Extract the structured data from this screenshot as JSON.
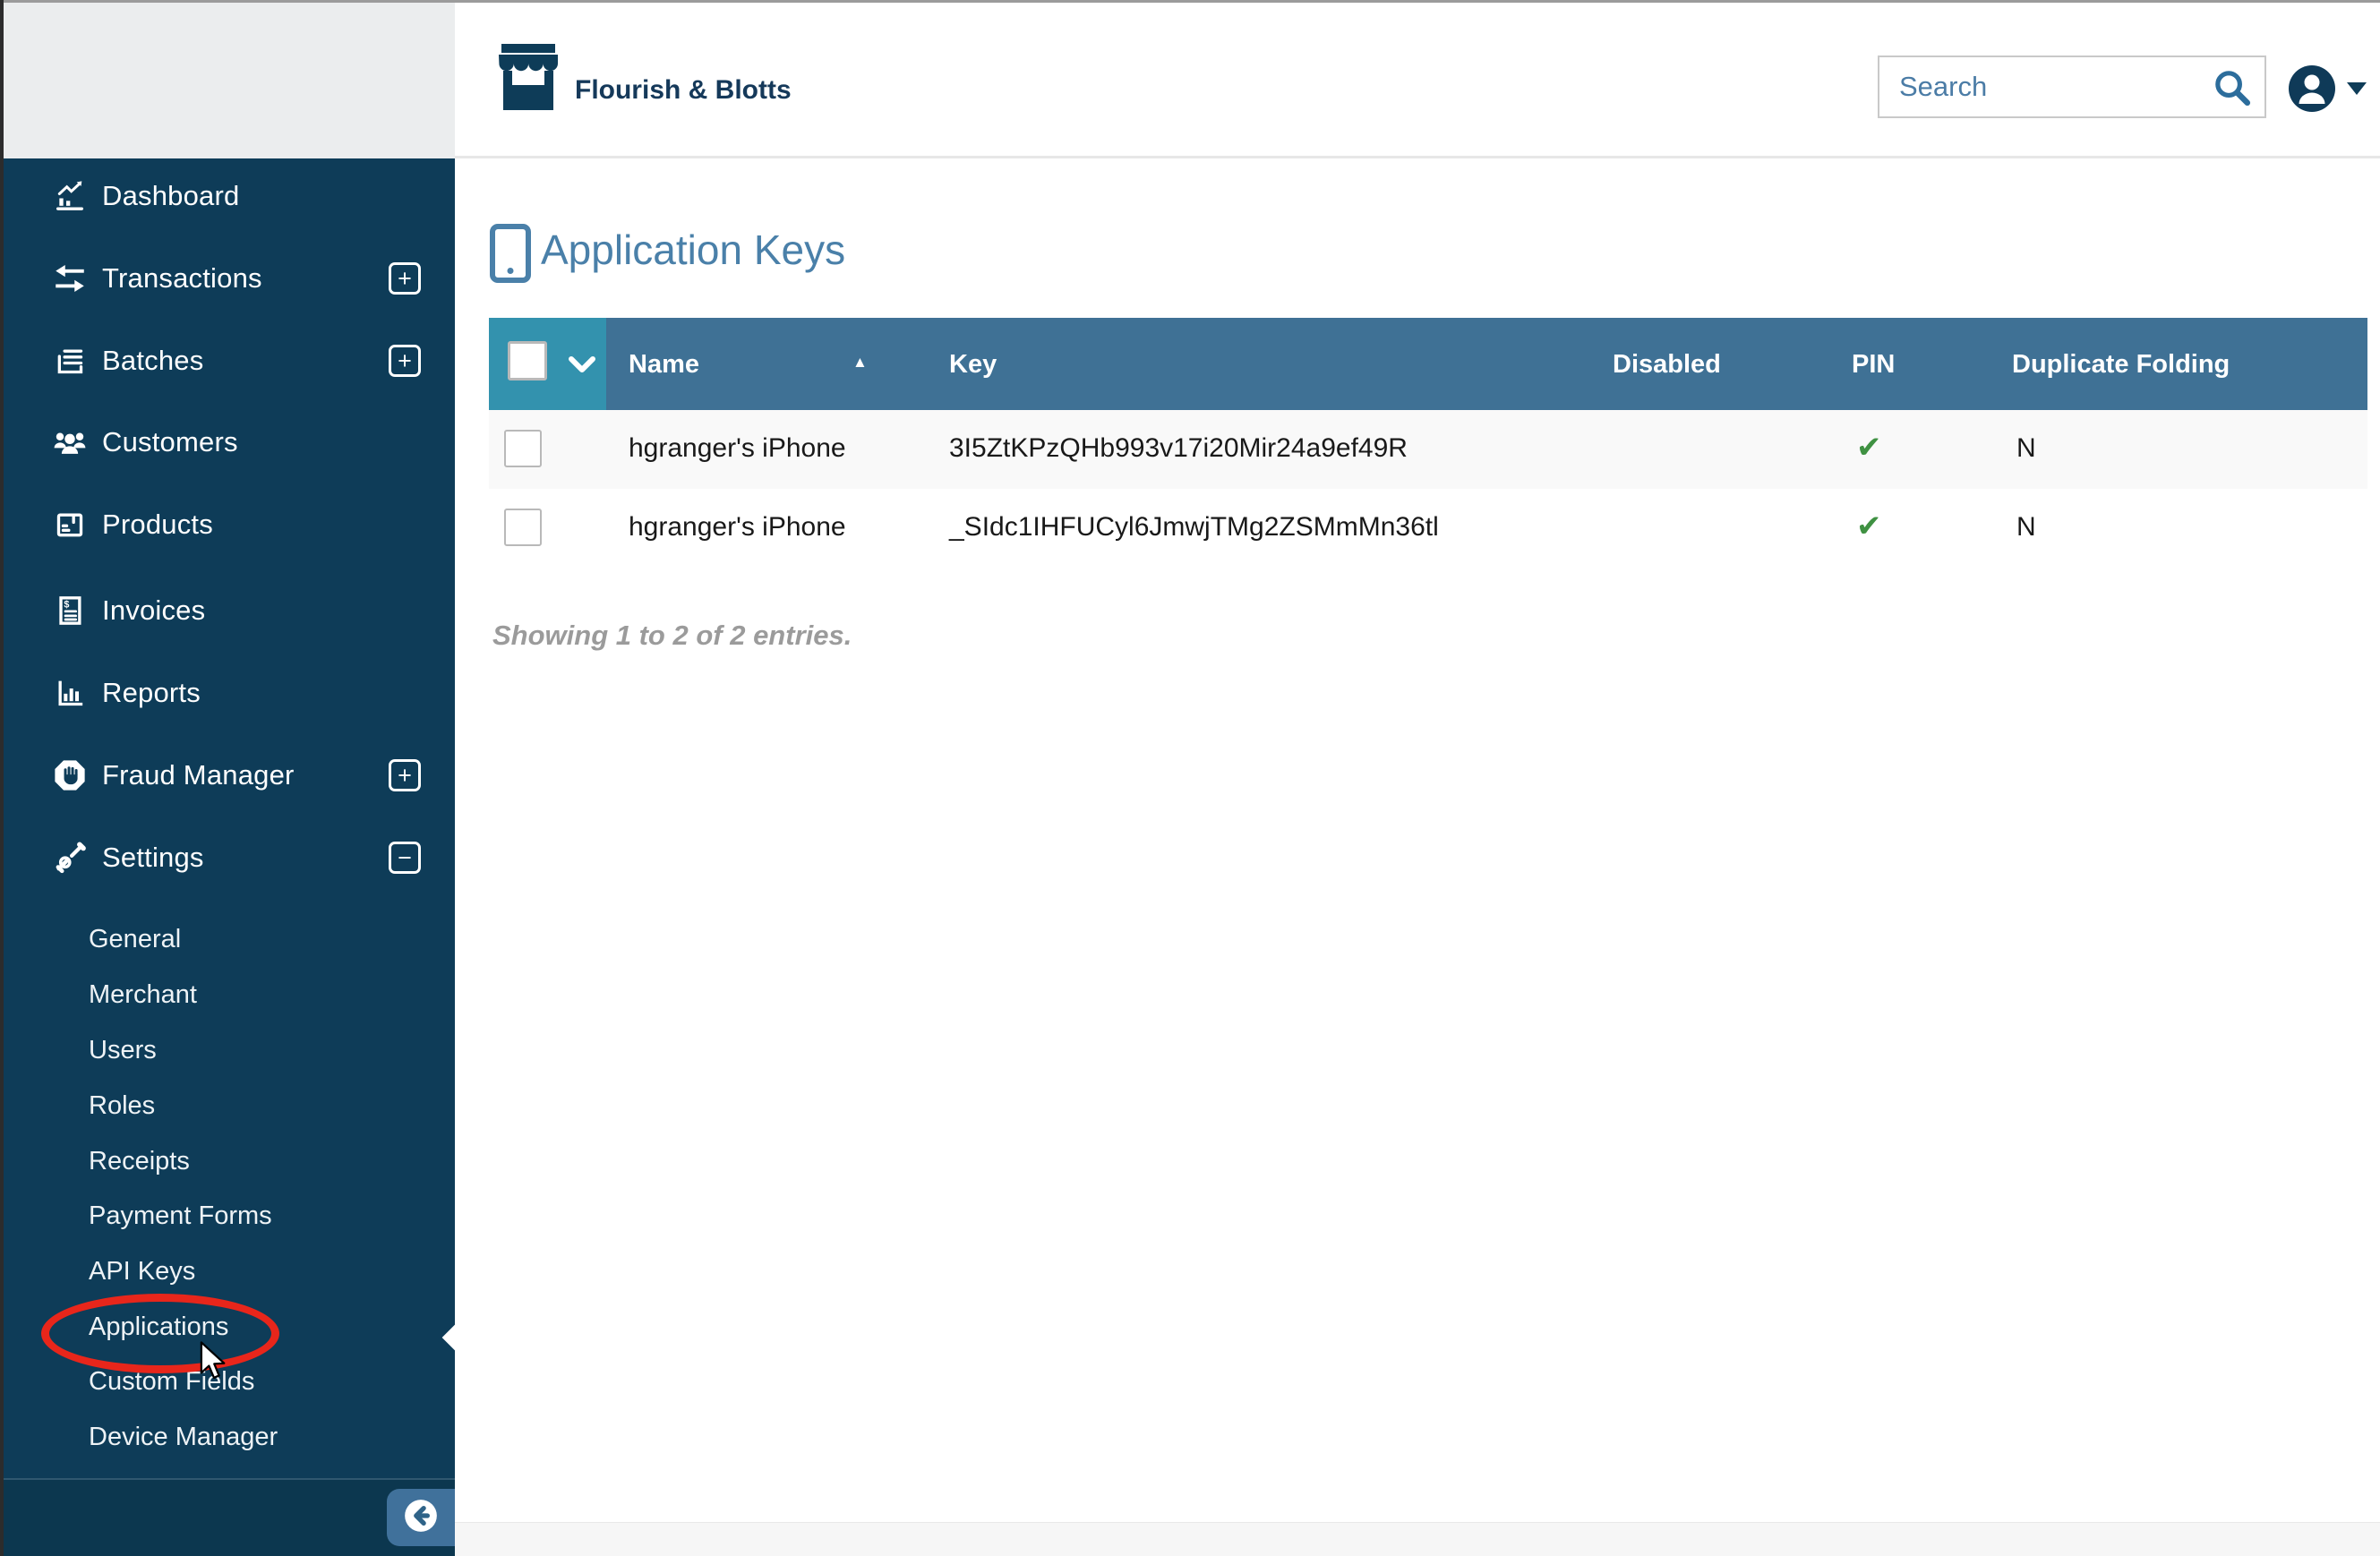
{
  "header": {
    "brand": "Flourish & Blotts",
    "search_placeholder": "Search"
  },
  "sidebar": {
    "items": [
      {
        "label": "Dashboard"
      },
      {
        "label": "Transactions",
        "expand": "+"
      },
      {
        "label": "Batches",
        "expand": "+"
      },
      {
        "label": "Customers"
      },
      {
        "label": "Products"
      },
      {
        "label": "Invoices"
      },
      {
        "label": "Reports"
      },
      {
        "label": "Fraud Manager",
        "expand": "+"
      },
      {
        "label": "Settings",
        "expand": "−"
      }
    ],
    "submenu": [
      {
        "label": "General"
      },
      {
        "label": "Merchant"
      },
      {
        "label": "Users"
      },
      {
        "label": "Roles"
      },
      {
        "label": "Receipts"
      },
      {
        "label": "Payment Forms"
      },
      {
        "label": "API Keys"
      },
      {
        "label": "Applications"
      },
      {
        "label": "Custom Fields"
      },
      {
        "label": "Device Manager"
      }
    ]
  },
  "main": {
    "title": "Application Keys",
    "table": {
      "columns": [
        "Name",
        "Key",
        "Disabled",
        "PIN",
        "Duplicate Folding"
      ],
      "sort_column": "Name",
      "sort_arrow": "▲",
      "rows": [
        {
          "name": "hgranger's iPhone",
          "key": "3I5ZtKPzQHb993v17i20Mir24a9ef49R",
          "disabled": "",
          "pin": "✔",
          "duplicate_folding": "N"
        },
        {
          "name": "hgranger's iPhone",
          "key": "_SIdc1IHFUCyl6JmwjTMg2ZSMmMn36tl",
          "disabled": "",
          "pin": "✔",
          "duplicate_folding": "N"
        }
      ]
    },
    "summary": "Showing 1 to 2 of 2 entries."
  },
  "annotation": {
    "circled_item": "Applications"
  },
  "colors": {
    "sidebar_navy": "#0e3c58",
    "table_header_blue": "#3f7195",
    "select_cell_teal": "#3392ae",
    "accent_blue": "#4a80a9",
    "check_green": "#3f9142",
    "annotation_red": "#e8261b",
    "collapse_button_blue": "#40719b"
  }
}
